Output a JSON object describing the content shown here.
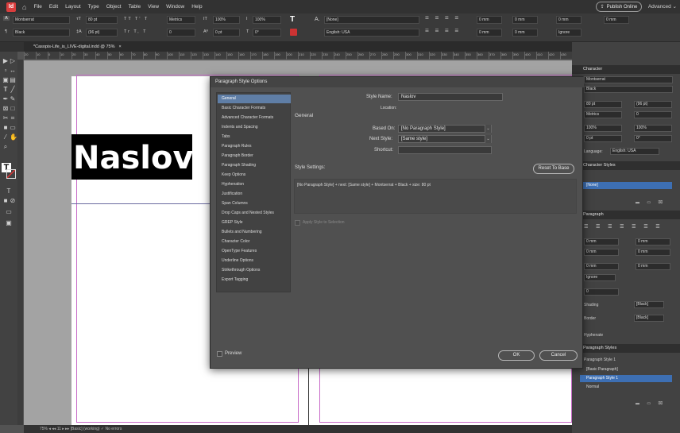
{
  "menubar": {
    "logo": "Id",
    "items": [
      "File",
      "Edit",
      "Layout",
      "Type",
      "Object",
      "Table",
      "View",
      "Window",
      "Help"
    ],
    "publish_label": "Publish Online",
    "workspace_label": "Advanced"
  },
  "controlbar": {
    "font_family": "Montserrat",
    "font_style": "Black",
    "font_size": "80 pt",
    "leading": "(96 pt)",
    "kerning": "Metrics",
    "tracking": "0",
    "vscale": "100%",
    "hscale": "100%",
    "baseline": "0 pt",
    "skew": "0°",
    "char_style": "[None]",
    "language": "English: USA",
    "indent_values": [
      "0 mm",
      "0 mm",
      "0 mm",
      "0 mm",
      "0 mm",
      "0 mm"
    ],
    "hyph_label": "Ignore"
  },
  "document": {
    "tab_label": "*Casopis-Life_is_LIVE-digital.indd @ 75%",
    "heading_text": "Naslov",
    "ruler_ticks": [
      "20",
      "10",
      "0",
      "10",
      "20",
      "30",
      "40",
      "50",
      "60",
      "70",
      "80",
      "90",
      "100",
      "110",
      "120",
      "130",
      "140",
      "150",
      "160",
      "170",
      "180",
      "190",
      "200",
      "210",
      "220",
      "230",
      "240",
      "250",
      "260",
      "270",
      "280",
      "290",
      "300",
      "310",
      "320",
      "330",
      "340",
      "350",
      "360",
      "370",
      "380",
      "390",
      "400",
      "410",
      "420",
      "430"
    ]
  },
  "statusbar": {
    "text": "75%   ◂  ◂◂  11  ▸  ▸▸   [Basic] (working)   ✓   No errors"
  },
  "character_panel": {
    "title": "Character",
    "font_family": "Montserrat",
    "font_style": "Black",
    "size": "80 pt",
    "leading": "(96 pt)",
    "kerning": "Metrics",
    "tracking": "0",
    "vscale": "100%",
    "hscale": "100%",
    "baseline": "0 pt",
    "skew": "0°",
    "language_label": "Language:",
    "language": "English: USA"
  },
  "character_styles_panel": {
    "title": "Character Styles",
    "items": [
      "[None]"
    ],
    "selected_item": "[None]"
  },
  "paragraph_panel": {
    "title": "Paragraph",
    "fields": [
      "0 mm",
      "0 mm",
      "0 mm",
      "0 mm",
      "0 mm",
      "0 mm"
    ],
    "hyph_select": "Ignore",
    "drop_cap": "0",
    "shading_label": "Shading",
    "shading_color": "[Black]",
    "border_label": "Border",
    "border_color": "[Black]",
    "hyphenate_label": "Hyphenate"
  },
  "paragraph_styles_panel": {
    "title": "Paragraph Styles",
    "current": "Paragraph Style 1",
    "items": [
      "[Basic Paragraph]",
      "Paragraph Style 1",
      "Normal"
    ],
    "selected_item": "Paragraph Style 1"
  },
  "dialog": {
    "title": "Paragraph Style Options",
    "categories": [
      "General",
      "Basic Character Formats",
      "Advanced Character Formats",
      "Indents and Spacing",
      "Tabs",
      "Paragraph Rules",
      "Paragraph Border",
      "Paragraph Shading",
      "Keep Options",
      "Hyphenation",
      "Justification",
      "Span Columns",
      "Drop Caps and Nested Styles",
      "GREP Style",
      "Bullets and Numbering",
      "Character Color",
      "OpenType Features",
      "Underline Options",
      "Strikethrough Options",
      "Export Tagging"
    ],
    "selected_category": "General",
    "style_name_label": "Style Name:",
    "style_name_value": "Naslov",
    "location_label": "Location:",
    "section_title": "General",
    "based_on_label": "Based On:",
    "based_on_value": "[No Paragraph Style]",
    "next_style_label": "Next Style:",
    "next_style_value": "[Same style]",
    "shortcut_label": "Shortcut:",
    "shortcut_value": "",
    "style_settings_label": "Style Settings:",
    "reset_label": "Reset To Base",
    "settings_text": "[No Paragraph Style] + next: [Same style] + Montserrat + Black + size: 80 pt",
    "apply_label": "Apply Style to Selection",
    "preview_label": "Preview",
    "ok_label": "OK",
    "cancel_label": "Cancel"
  },
  "colors": {
    "accent_selected": "#3d6fb3",
    "list_selected": "#5f7ea6",
    "margin_guide": "#c86bc8",
    "logo_red": "#d93d3d"
  }
}
